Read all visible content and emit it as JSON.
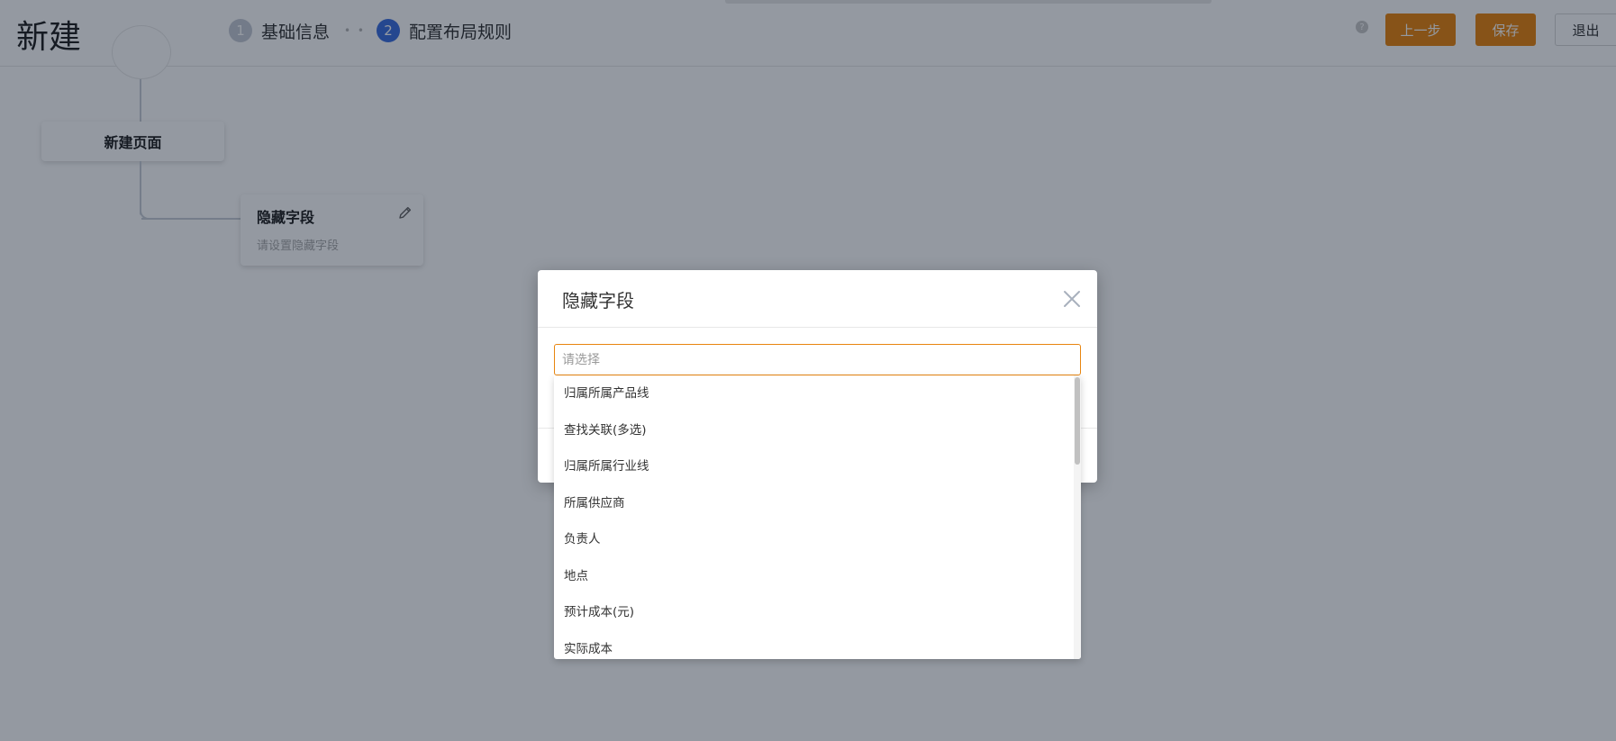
{
  "header": {
    "title": "新建",
    "steps": [
      {
        "number": "1",
        "label": "基础信息",
        "state": "inactive"
      },
      {
        "number": "2",
        "label": "配置布局规则",
        "state": "active"
      }
    ],
    "step_separator": "• •",
    "help_icon": "question-circle-icon",
    "help_glyph": "?",
    "buttons": {
      "prev": "上一步",
      "save": "保存",
      "exit": "退出"
    }
  },
  "canvas": {
    "page_node_label": "新建页面",
    "hidden_field_card": {
      "title": "隐藏字段",
      "description": "请设置隐藏字段",
      "edit_icon": "pencil-icon"
    }
  },
  "dialog": {
    "title": "隐藏字段",
    "close_icon": "close-icon",
    "select": {
      "placeholder": "请选择",
      "value": ""
    },
    "options": [
      "归属所属产品线",
      "查找关联(多选)",
      "归属所属行业线",
      "所属供应商",
      "负责人",
      "地点",
      "预计成本(元)",
      "实际成本"
    ]
  },
  "colors": {
    "accent_orange": "#e8850f",
    "active_step_blue": "#3d6fe0",
    "inactive_step_gray": "#c6cbd5",
    "overlay": "rgba(8,18,36,0.43)"
  }
}
